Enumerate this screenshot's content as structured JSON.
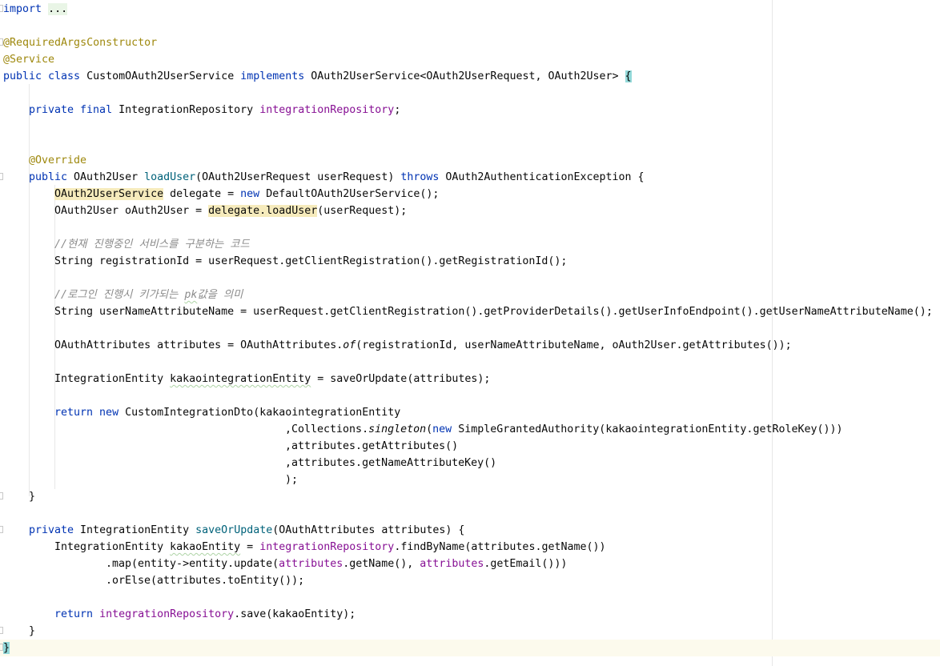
{
  "code": {
    "import_kw": "import",
    "import_fold": "...",
    "ann_required": "@RequiredArgsConstructor",
    "ann_service": "@Service",
    "class_decl_a": "public class ",
    "class_name": "CustomOAuth2UserService",
    "class_decl_b": " implements ",
    "class_decl_c": "OAuth2UserService<OAuth2UserRequest, OAuth2User> ",
    "class_brace": "{",
    "field_mod": "private final ",
    "field_type": "IntegrationRepository ",
    "field_name": "integrationRepository",
    "field_semi": ";",
    "ann_override": "@Override",
    "ml_public": "public ",
    "ml_type": "OAuth2User ",
    "ml_name": "loadUser",
    "ml_params": "(OAuth2UserRequest userRequest) ",
    "ml_throws": "throws",
    "ml_ex": " OAuth2AuthenticationException {",
    "l1_type": "OAuth2UserService",
    "l1_mid": " delegate = ",
    "l1_new": "new",
    "l1_end": " DefaultOAuth2UserService();",
    "l2_start": "OAuth2User oAuth2User = ",
    "l2_hl": "delegate.loadUser",
    "l2_end": "(userRequest);",
    "comment1": "//현재 진행중인 서비스를 구분하는 코드",
    "l3": "String registrationId = userRequest.getClientRegistration().getRegistrationId();",
    "comment2_a": "//로그인 진행시 키가되는 ",
    "comment2_pk": "pk",
    "comment2_b": "값을 의미",
    "l4": "String userNameAttributeName = userRequest.getClientRegistration().getProviderDetails().getUserInfoEndpoint().getUserNameAttributeName();",
    "l5_a": "OAuthAttributes attributes = OAuthAttributes.",
    "l5_of": "of",
    "l5_b": "(registrationId, userNameAttributeName, oAuth2User.getAttributes());",
    "l6_a": "IntegrationEntity ",
    "l6_var": "kakaointegrationEntity",
    "l6_b": " = saveOrUpdate(attributes);",
    "r_return": "return",
    "r_new": " new",
    "r_a": " CustomIntegrationDto(kakaointegrationEntity",
    "r2_a": ",Collections.",
    "r2_singleton": "singleton",
    "r2_open": "(",
    "r2_new": "new",
    "r2_b": " SimpleGrantedAuthority(kakaointegrationEntity.getRoleKey()))",
    "r3": ",attributes.getAttributes()",
    "r4": ",attributes.getNameAttributeKey()",
    "r5": ");",
    "close_method": "}",
    "m2_private": "private ",
    "m2_type": "IntegrationEntity ",
    "m2_name": "saveOrUpdate",
    "m2_params": "(OAuthAttributes attributes) {",
    "m2l1_a": "IntegrationEntity ",
    "m2l1_var": "kakaoEntity",
    "m2l1_b": " = ",
    "m2l1_repo": "integrationRepository",
    "m2l1_c": ".findByName(attributes.getName())",
    "m2l2_a": ".map(entity->entity.update(",
    "m2l2_attr1": "attributes",
    "m2l2_b": ".getName(), ",
    "m2l2_attr2": "attributes",
    "m2l2_c": ".getEmail()))",
    "m2l3": ".orElse(attributes.toEntity());",
    "m2r_return": "return",
    "m2r_sp": " ",
    "m2r_repo": "integrationRepository",
    "m2r_end": ".save(kakaoEntity);",
    "close_method2": "}",
    "close_class": "}"
  }
}
